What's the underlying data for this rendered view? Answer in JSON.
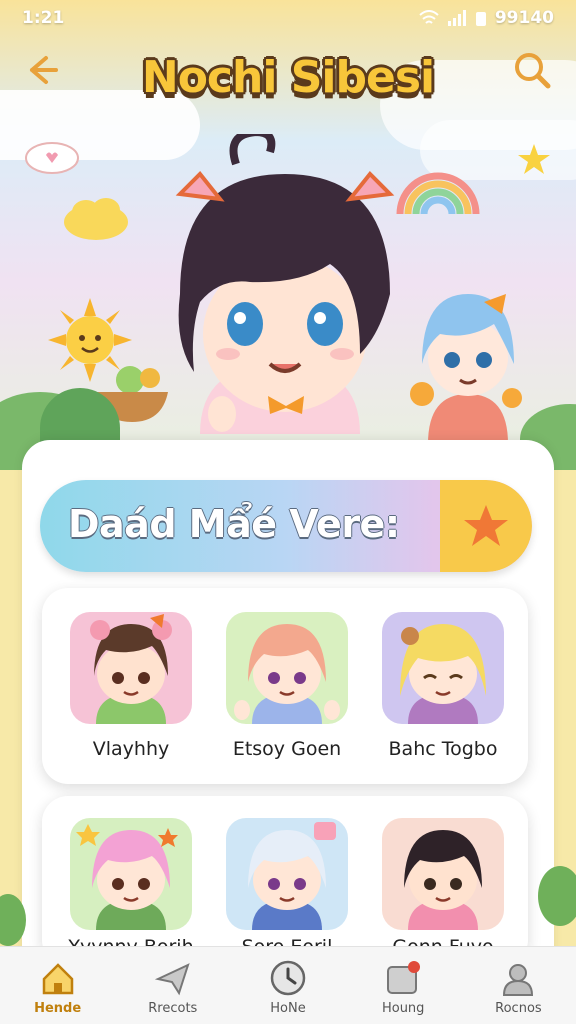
{
  "status": {
    "time": "1:21",
    "right": "99140"
  },
  "header": {
    "title": "Nochi Sibesi"
  },
  "banner": {
    "text": "Daád Mẩé Vere:"
  },
  "characters": [
    {
      "name": "Vlayhhy"
    },
    {
      "name": "Etsoy Goen"
    },
    {
      "name": "Bahc Togbo"
    },
    {
      "name": "Yyynnv Borih"
    },
    {
      "name": "Soro Eoril"
    },
    {
      "name": "Gonn Fuvo"
    }
  ],
  "tabs": [
    {
      "label": "Hende",
      "icon": "home-icon"
    },
    {
      "label": "Rrecots",
      "icon": "paper-plane-icon"
    },
    {
      "label": "HoNe",
      "icon": "clock-icon"
    },
    {
      "label": "Houng",
      "icon": "calendar-icon"
    },
    {
      "label": "Rocnos",
      "icon": "profile-icon"
    }
  ],
  "colors": {
    "accent": "#f8c63a",
    "tab_active": "#c0800e",
    "title_outline": "#5a3a1c"
  }
}
